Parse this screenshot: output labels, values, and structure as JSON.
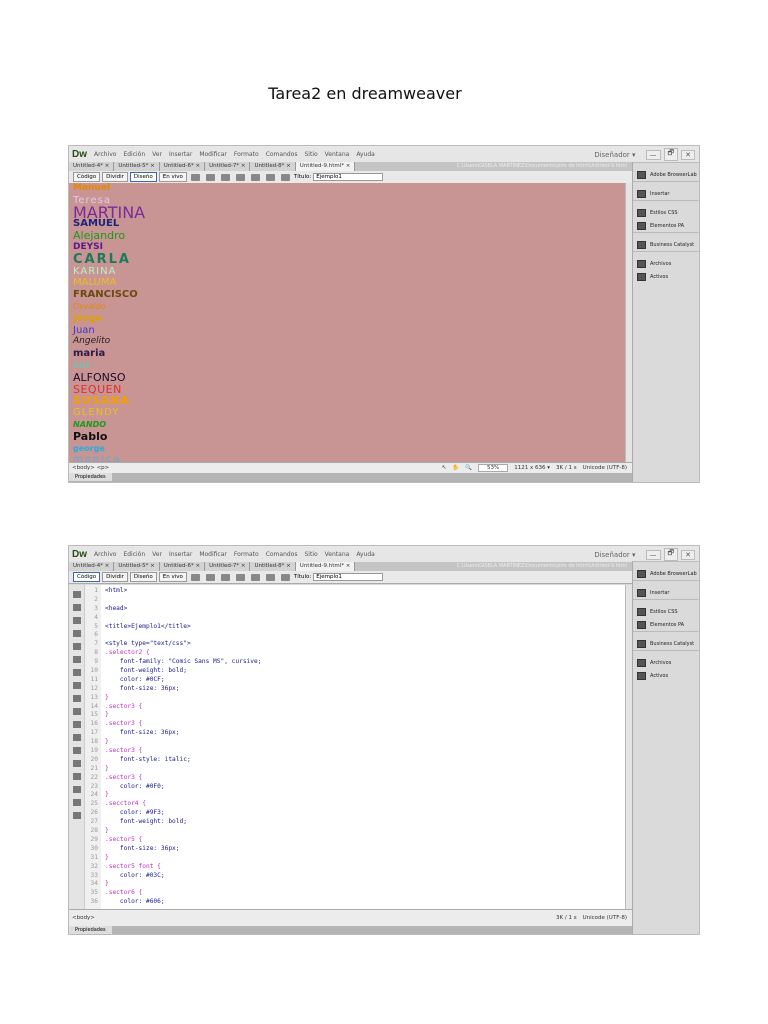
{
  "doc_title": "Tarea2 en dreamweaver",
  "app": {
    "logo": "Dw",
    "menu": [
      "Archivo",
      "Edición",
      "Ver",
      "Insertar",
      "Modificar",
      "Formato",
      "Comandos",
      "Sitio",
      "Ventana",
      "Ayuda"
    ],
    "workspace": "Diseñador ▾",
    "controls": [
      "—",
      "🗗",
      "✕"
    ]
  },
  "tabs": [
    "Untitled-4* ×",
    "Untitled-5* ×",
    "Untitled-6* ×",
    "Untitled-7* ×",
    "Untitled-8* ×",
    "Untitled-9.html* ×"
  ],
  "file_path": "C:\\Users\\GISELA MARTINEZ\\Documents\\sitio de htlm\\Untitled-9.html",
  "view_buttons": [
    "Código",
    "Dividir",
    "Diseño",
    "En vivo"
  ],
  "title_label": "Título:",
  "title_value": "Ejemplo1",
  "panel": [
    "Adobe BrowserLab",
    "Insertar",
    "Estilos CSS",
    "Elementos PA",
    "Business Catalyst",
    "Archivos",
    "Activos"
  ],
  "screen1": {
    "names": [
      {
        "t": "Manuel",
        "c": "#e08a00"
      },
      {
        "t": "Teresa",
        "c": "#e3c8e8"
      },
      {
        "t": "MARTINA",
        "c": "#7a2a9a"
      },
      {
        "t": "SAMUEL",
        "c": "#1a237e"
      },
      {
        "t": "Alejandro",
        "c": "#1a9a1a"
      },
      {
        "t": "DEYSI",
        "c": "#5a1a8a"
      },
      {
        "t": "CARLA",
        "c": "#1a7a5a"
      },
      {
        "t": "KARINA",
        "c": "#b8f0c8"
      },
      {
        "t": "MALUMA",
        "c": "#e8c020"
      },
      {
        "t": "FRANCISCO",
        "c": "#6a4a10"
      },
      {
        "t": "Osvaldo",
        "c": "#e08a00"
      },
      {
        "t": "jorge",
        "c": "#e0a000"
      },
      {
        "t": "Juan",
        "c": "#3a3acf"
      },
      {
        "t": "Angelito",
        "c": "#222"
      },
      {
        "t": "maria",
        "c": "#2a1a4a"
      },
      {
        "t": "luis",
        "c": "#5ad0b0"
      },
      {
        "t": "ALFONSO",
        "c": "#1a0a2a"
      },
      {
        "t": "SEQUEN",
        "c": "#e03030"
      },
      {
        "t": "SUSANA",
        "c": "#f0a000"
      },
      {
        "t": "GLENDY",
        "c": "#e8c020"
      },
      {
        "t": "NANDO",
        "c": "#1a9a1a"
      },
      {
        "t": "Pablo",
        "c": "#111"
      },
      {
        "t": "george",
        "c": "#20b0e0"
      },
      {
        "t": "monica",
        "c": "#5ab0d0"
      }
    ],
    "tag_path": "<body> <p>",
    "zoom": "53%",
    "dimensions": "1121 x 636 ▾",
    "size_time": "3K / 1 s",
    "encoding": "Unicode (UTF-8)",
    "properties": "Propiedades"
  },
  "screen2": {
    "lines": [
      "<html>",
      "",
      "<head>",
      "",
      "<title>Ejemplo1</title>",
      "",
      "<style type=\"text/css\">",
      ".selector2 {",
      "    font-family: \"Comic Sans MS\", cursive;",
      "    font-weight: bold;",
      "    color: #0CF;",
      "    font-size: 36px;",
      "}",
      ".sector3 {",
      "}",
      ".sector3 {",
      "    font-size: 36px;",
      "}",
      ".sector3 {",
      "    font-style: italic;",
      "}",
      ".sector3 {",
      "    color: #0F0;",
      "}",
      ".secctor4 {",
      "    color: #9F3;",
      "    font-weight: bold;",
      "}",
      ".sector5 {",
      "    font-size: 36px;",
      "}",
      ".sector5 font {",
      "    color: #03C;",
      "}",
      ".sector6 {",
      "    color: #606;"
    ],
    "tag_path": "<body>",
    "size_time": "3K / 1 s",
    "encoding": "Unicode (UTF-8)",
    "properties": "Propiedades"
  }
}
